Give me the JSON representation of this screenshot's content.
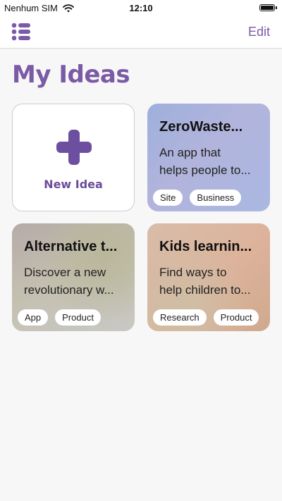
{
  "status_bar": {
    "carrier": "Nenhum SIM",
    "time": "12:10"
  },
  "nav": {
    "edit_label": "Edit",
    "menu_icon": "list-icon"
  },
  "page": {
    "title": "My Ideas"
  },
  "new_card": {
    "label": "New Idea",
    "icon": "plus-icon",
    "accent": "#6d4fa0"
  },
  "colors": {
    "accent": "#7b5aa6"
  },
  "cards": [
    {
      "title": "ZeroWaste...",
      "desc_line1": "An app that",
      "desc_line2": "helps people to...",
      "tags": [
        "Site",
        "Business"
      ]
    },
    {
      "title": "Alternative t...",
      "desc_line1": "Discover a new",
      "desc_line2": "revolutionary w...",
      "tags": [
        "App",
        "Product"
      ]
    },
    {
      "title": "Kids learnin...",
      "desc_line1": "Find ways to",
      "desc_line2": "help children to...",
      "tags": [
        "Research",
        "Product"
      ]
    }
  ]
}
